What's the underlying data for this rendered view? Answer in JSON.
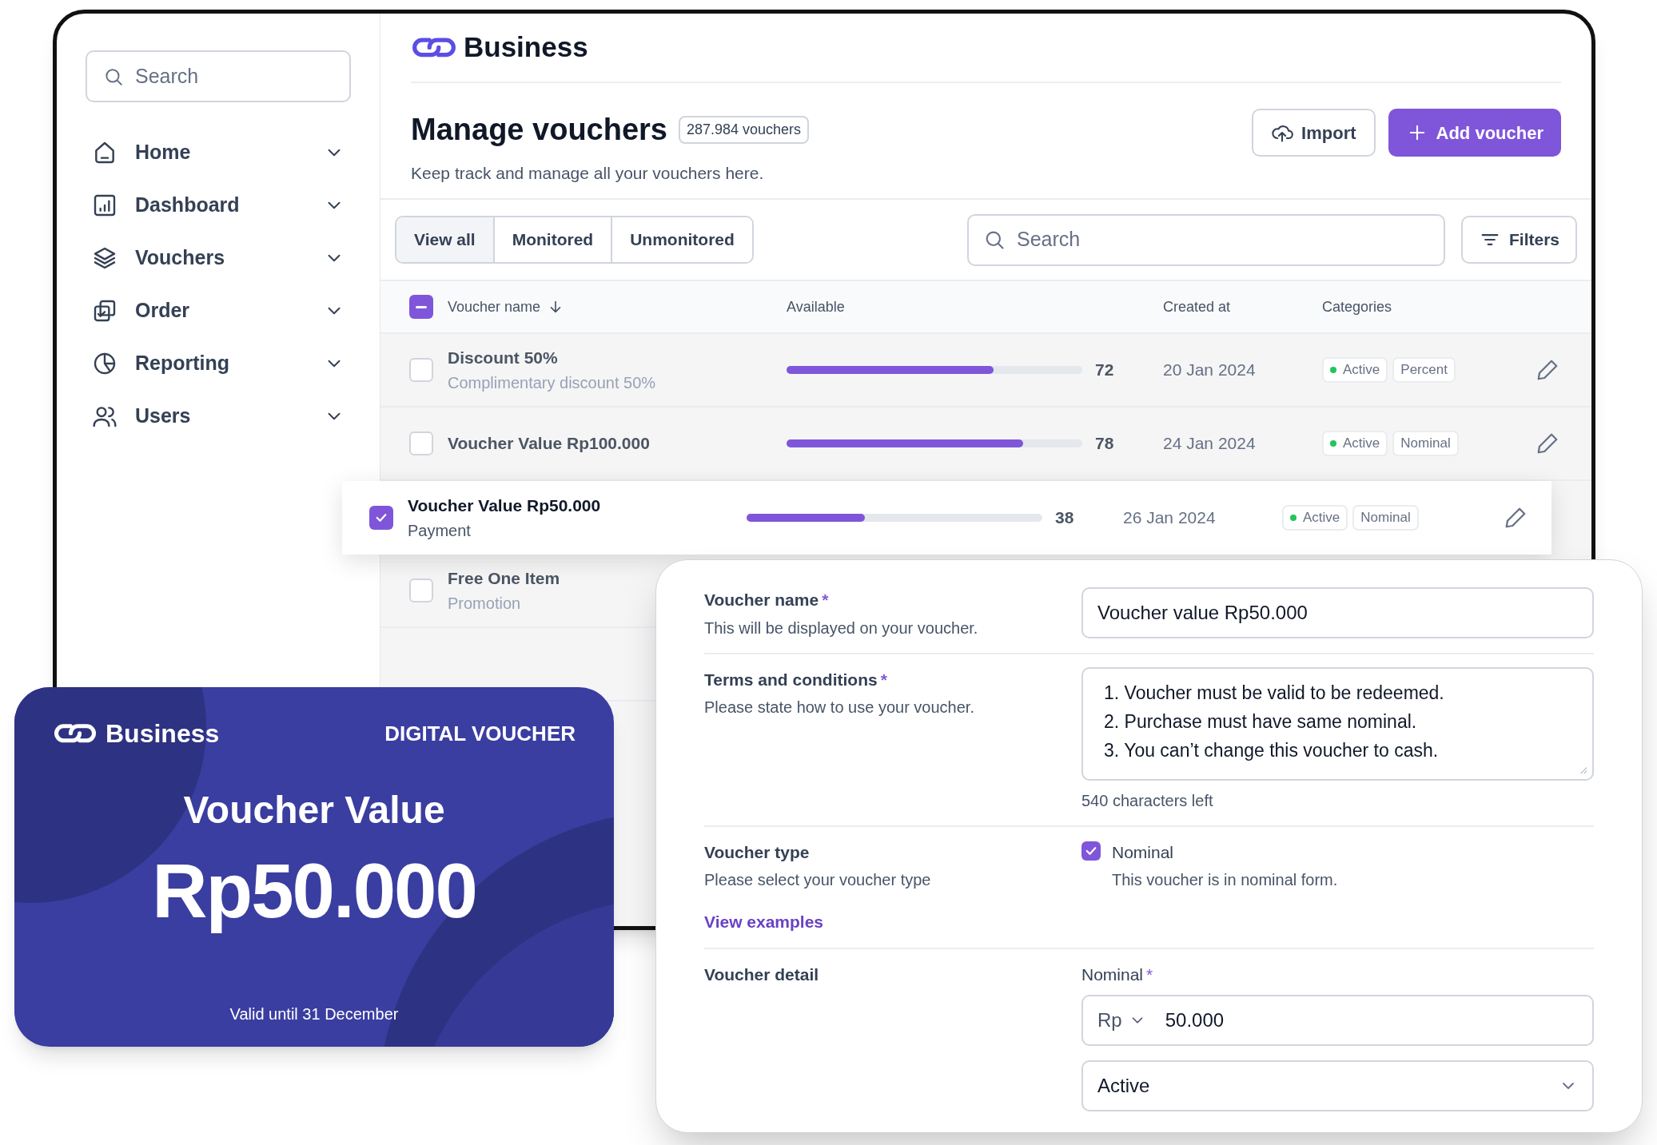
{
  "sidebar": {
    "search": {
      "placeholder": "Search"
    },
    "nav": [
      {
        "label": "Home"
      },
      {
        "label": "Dashboard"
      },
      {
        "label": "Vouchers"
      },
      {
        "label": "Order"
      },
      {
        "label": "Reporting"
      },
      {
        "label": "Users"
      }
    ]
  },
  "header": {
    "brand": "Business"
  },
  "page": {
    "title": "Manage vouchers",
    "count_badge": "287.984 vouchers",
    "subtitle": "Keep track and manage all your vouchers here.",
    "buttons": [
      {
        "label": "Import",
        "kind": "secondary"
      },
      {
        "label": "Add voucher",
        "kind": "primary"
      }
    ]
  },
  "tabs": [
    {
      "label": "View all",
      "selected": true
    },
    {
      "label": "Monitored",
      "selected": false
    },
    {
      "label": "Unmonitored",
      "selected": false
    }
  ],
  "search": {
    "placeholder": "Search"
  },
  "filters_button": "Filters",
  "table": {
    "select_all": {
      "indeterminate": true
    },
    "columns": [
      "Voucher name",
      "Available",
      "Created at",
      "Categories"
    ],
    "rows": [
      {
        "name": "Discount 50%",
        "subtitle": "Complimentary discount 50%",
        "level": 0.7,
        "available": "72",
        "created": "20 Jan 2024",
        "categories": [
          {
            "label": "Active",
            "color": "#22c55e"
          },
          {
            "label": "Percent"
          }
        ],
        "selected": false
      },
      {
        "name": "Voucher Value Rp100.000",
        "level": 0.8,
        "available": "78",
        "created": "24 Jan 2024",
        "categories": [
          {
            "label": "Active",
            "color": "#22c55e"
          },
          {
            "label": "Nominal"
          }
        ],
        "selected": false
      },
      {
        "name": "Voucher Value Rp50.000",
        "subtitle": "Payment",
        "level": 0.4,
        "available": "38",
        "created": "26 Jan 2024",
        "categories": [
          {
            "label": "Active",
            "color": "#22c55e"
          },
          {
            "label": "Nominal"
          }
        ],
        "selected": true
      },
      {
        "name": "Free One Item",
        "subtitle": "Promotion",
        "selected": false
      }
    ]
  },
  "form": {
    "fields": [
      {
        "kind": "text",
        "label": "Voucher name",
        "required_mark": "*",
        "hint": "This will be displayed on your voucher.",
        "value": "Voucher value Rp50.000"
      },
      {
        "kind": "textarea",
        "label": "Terms and conditions",
        "required_mark": "*",
        "hint": "Please state how to use your voucher.",
        "lines": [
          "1. Voucher must be valid to be redeemed.",
          "2. Purchase must have same nominal.",
          "3. You can’t change this voucher to cash."
        ],
        "counter": "540 characters left"
      },
      {
        "kind": "checkbox",
        "label": "Voucher type",
        "hint": "Please select your voucher type",
        "link": "View examples",
        "option": {
          "label": "Nominal",
          "description": "This voucher is in nominal form.",
          "checked": true
        }
      },
      {
        "kind": "detail",
        "label": "Voucher detail",
        "sub_label": "Nominal",
        "sub_required_mark": "*",
        "currency": "Rp",
        "value": "50.000",
        "status": "Active"
      }
    ]
  },
  "voucher_card": {
    "brand": "Business",
    "tag": "DIGITAL VOUCHER",
    "title": "Voucher Value",
    "amount": "Rp50.000",
    "validity": "Valid until 31 December"
  }
}
